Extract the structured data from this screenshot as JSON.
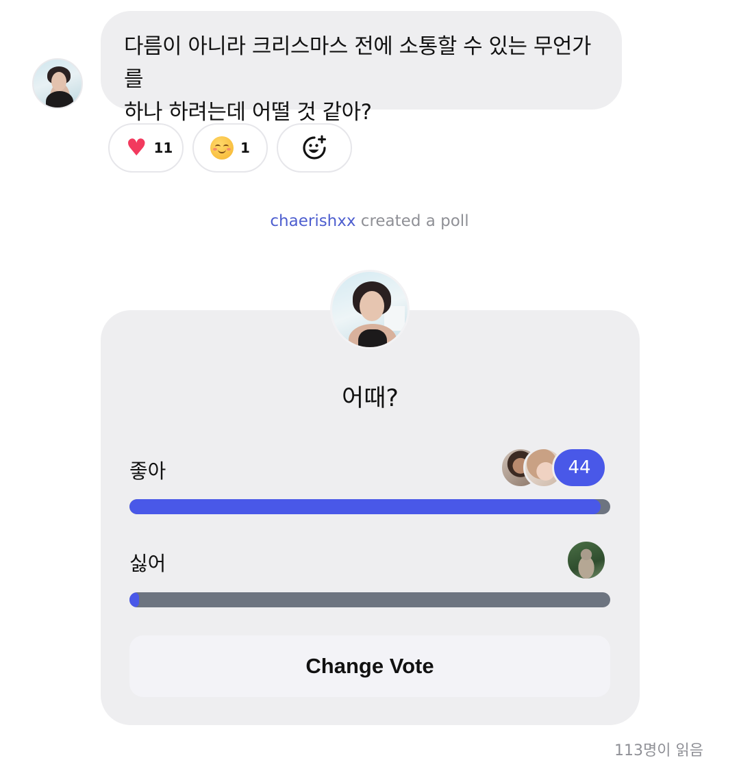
{
  "message": {
    "line1": "다름이 아니라 크리스마스 전에 소통할 수 있는 무언가를",
    "line2": "하나 하려는데 어떨 것 같아?"
  },
  "reactions": [
    {
      "icon": "heart-icon",
      "count": "11"
    },
    {
      "icon": "smiling-face-icon",
      "count": "1"
    },
    {
      "icon": "add-reaction-icon",
      "count": ""
    }
  ],
  "system": {
    "username": "chaerishxx",
    "text": " created a poll"
  },
  "poll": {
    "question": "어때?",
    "options": [
      {
        "label": "좋아",
        "vote_count": "44",
        "fill_fraction": 0.98
      },
      {
        "label": "싫어",
        "vote_count": "",
        "fill_fraction": 0.02
      }
    ],
    "button_label": "Change Vote",
    "accent_color": "#4958e8",
    "track_color": "#6d7480"
  },
  "footer": {
    "read_count": "113명이 읽음"
  }
}
